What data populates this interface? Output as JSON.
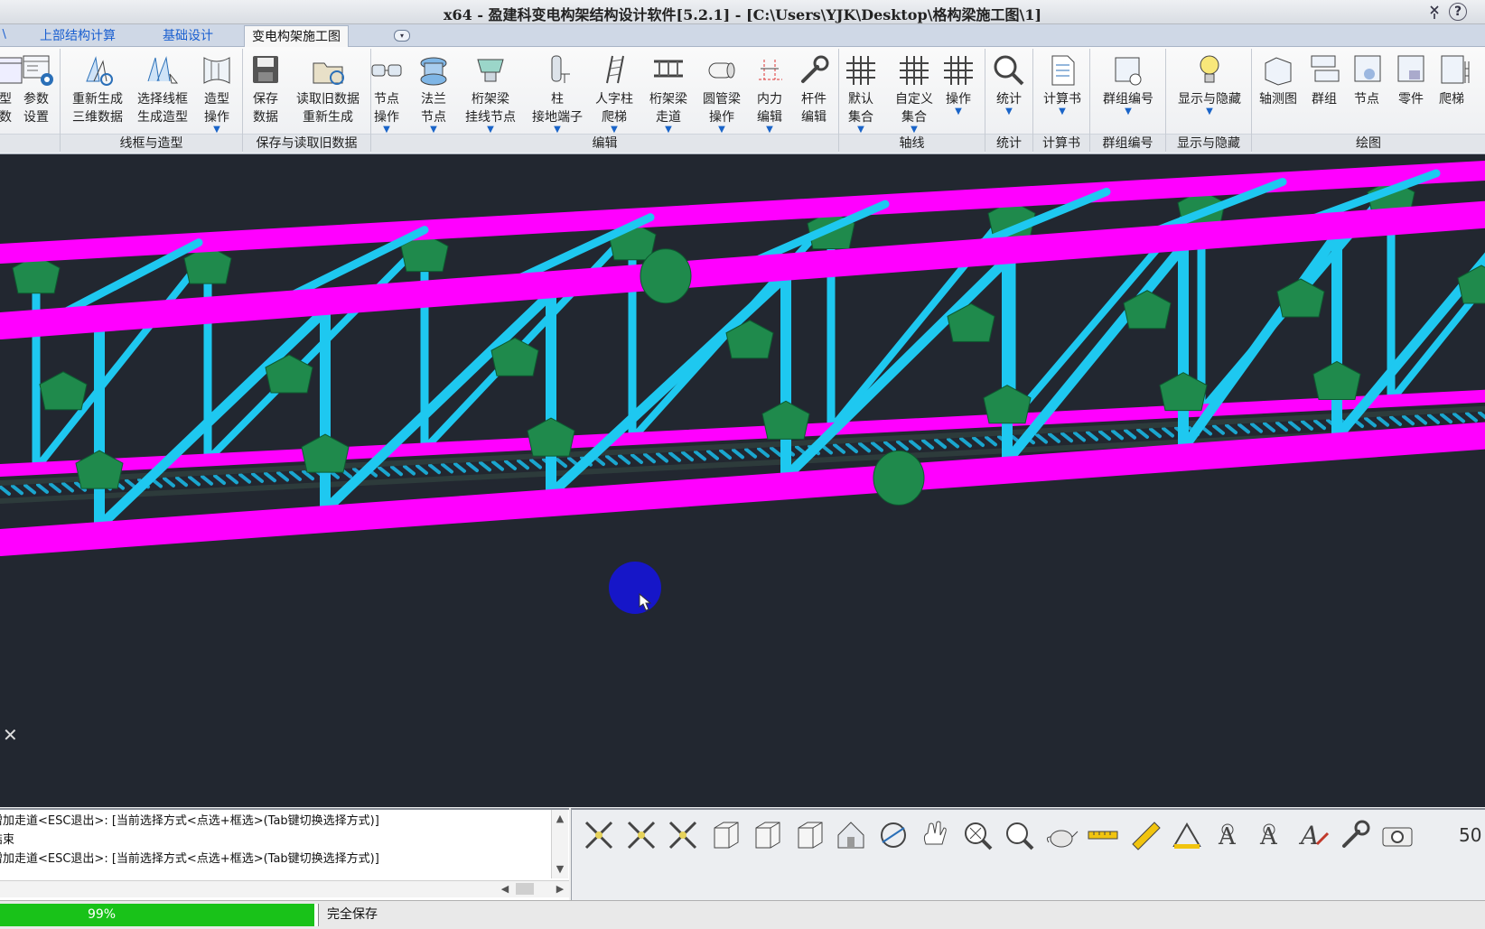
{
  "window": {
    "title": "x64 - 盈建科变电构架结构设计软件[5.2.1] - [C:\\Users\\YJK\\Desktop\\格构梁施工图\\1]",
    "buttons": [
      "pin-icon",
      "help-icon"
    ],
    "help_label": "?"
  },
  "tabs": [
    {
      "label": "上部结构计算",
      "active": false
    },
    {
      "label": "基础设计",
      "active": false
    },
    {
      "label": "变电构架施工图",
      "active": true
    }
  ],
  "ribbon": {
    "buttons": [
      {
        "l1": "型",
        "l2": "数",
        "icon": "model-icon",
        "arrow": false
      },
      {
        "l1": "参数",
        "l2": "设置",
        "icon": "settings-icon",
        "arrow": false
      },
      {
        "l1": "重新生成",
        "l2": "三维数据",
        "icon": "regen-3d-icon",
        "arrow": false
      },
      {
        "l1": "选择线框",
        "l2": "生成造型",
        "icon": "wireframe-icon",
        "arrow": false
      },
      {
        "l1": "造型",
        "l2": "操作",
        "icon": "shape-icon",
        "arrow": true
      },
      {
        "l1": "保存",
        "l2": "数据",
        "icon": "save-icon",
        "arrow": false
      },
      {
        "l1": "读取旧数据",
        "l2": "重新生成",
        "icon": "open-folder-icon",
        "arrow": false
      },
      {
        "l1": "节点",
        "l2": "操作",
        "icon": "node-icon",
        "arrow": true
      },
      {
        "l1": "法兰",
        "l2": "节点",
        "icon": "flange-icon",
        "arrow": true
      },
      {
        "l1": "桁架梁",
        "l2": "挂线节点",
        "icon": "truss-node-icon",
        "arrow": true
      },
      {
        "l1": "柱",
        "l2": "接地端子",
        "icon": "column-icon",
        "arrow": true
      },
      {
        "l1": "人字柱",
        "l2": "爬梯",
        "icon": "ladder-icon",
        "arrow": true
      },
      {
        "l1": "桁架梁",
        "l2": "走道",
        "icon": "walkway-icon",
        "arrow": true
      },
      {
        "l1": "圆管梁",
        "l2": "操作",
        "icon": "pipe-icon",
        "arrow": true
      },
      {
        "l1": "内力",
        "l2": "编辑",
        "icon": "force-icon",
        "arrow": true
      },
      {
        "l1": "杆件",
        "l2": "编辑",
        "icon": "wrench-icon",
        "arrow": false
      },
      {
        "l1": "默认",
        "l2": "集合",
        "icon": "grid-icon",
        "arrow": true
      },
      {
        "l1": "自定义",
        "l2": "集合",
        "icon": "grid-icon",
        "arrow": true
      },
      {
        "l1": "操作",
        "l2": "",
        "icon": "grid-icon",
        "arrow": true
      },
      {
        "l1": "统计",
        "l2": "",
        "icon": "magnifier-icon",
        "arrow": true
      },
      {
        "l1": "计算书",
        "l2": "",
        "icon": "document-icon",
        "arrow": true
      },
      {
        "l1": "群组编号",
        "l2": "",
        "icon": "group-number-icon",
        "arrow": true
      },
      {
        "l1": "显示与隐藏",
        "l2": "",
        "icon": "lightbulb-icon",
        "arrow": true
      },
      {
        "l1": "轴测图",
        "l2": "",
        "icon": "axonometric-icon",
        "arrow": false
      },
      {
        "l1": "群组",
        "l2": "",
        "icon": "group-icon",
        "arrow": false
      },
      {
        "l1": "节点",
        "l2": "",
        "icon": "node-drawing-icon",
        "arrow": false
      },
      {
        "l1": "零件",
        "l2": "",
        "icon": "part-icon",
        "arrow": false
      },
      {
        "l1": "爬梯",
        "l2": "",
        "icon": "ladder-drawing-icon",
        "arrow": false
      }
    ],
    "groups": [
      {
        "label": "线框与造型"
      },
      {
        "label": "保存与读取旧数据"
      },
      {
        "label": "编辑"
      },
      {
        "label": "轴线"
      },
      {
        "label": "统计"
      },
      {
        "label": "计算书"
      },
      {
        "label": "群组编号"
      },
      {
        "label": "显示与隐藏"
      },
      {
        "label": "绘图"
      }
    ]
  },
  "viewport": {
    "background": "#222730",
    "chord_color": "#ff00ff",
    "member_color": "#1ec8f0",
    "plate_color": "#1f8a4c"
  },
  "command": {
    "lines": [
      "增加走道<ESC退出>: [当前选择方式<点选+框选>(Tab键切换选择方式)]",
      "结束",
      "增加走道<ESC退出>: [当前选择方式<点选+框选>(Tab键切换选择方式)]"
    ]
  },
  "toolbar": {
    "tools": [
      "select-cross-icon",
      "select-cross-icon",
      "select-cross-icon",
      "cube-view-icon",
      "cube-view-icon",
      "cube-view-icon",
      "home-view-icon",
      "orbit-icon",
      "pan-hand-icon",
      "zoom-extents-icon",
      "zoom-icon",
      "teapot-icon",
      "measure-icon",
      "ruler-icon",
      "angle-icon",
      "text-icon",
      "text-icon",
      "text-style-icon",
      "wrench-icon",
      "camera-icon"
    ],
    "zoom_value": "50"
  },
  "status": {
    "progress": 0.99,
    "progress_label": "99%",
    "message": "完全保存"
  }
}
